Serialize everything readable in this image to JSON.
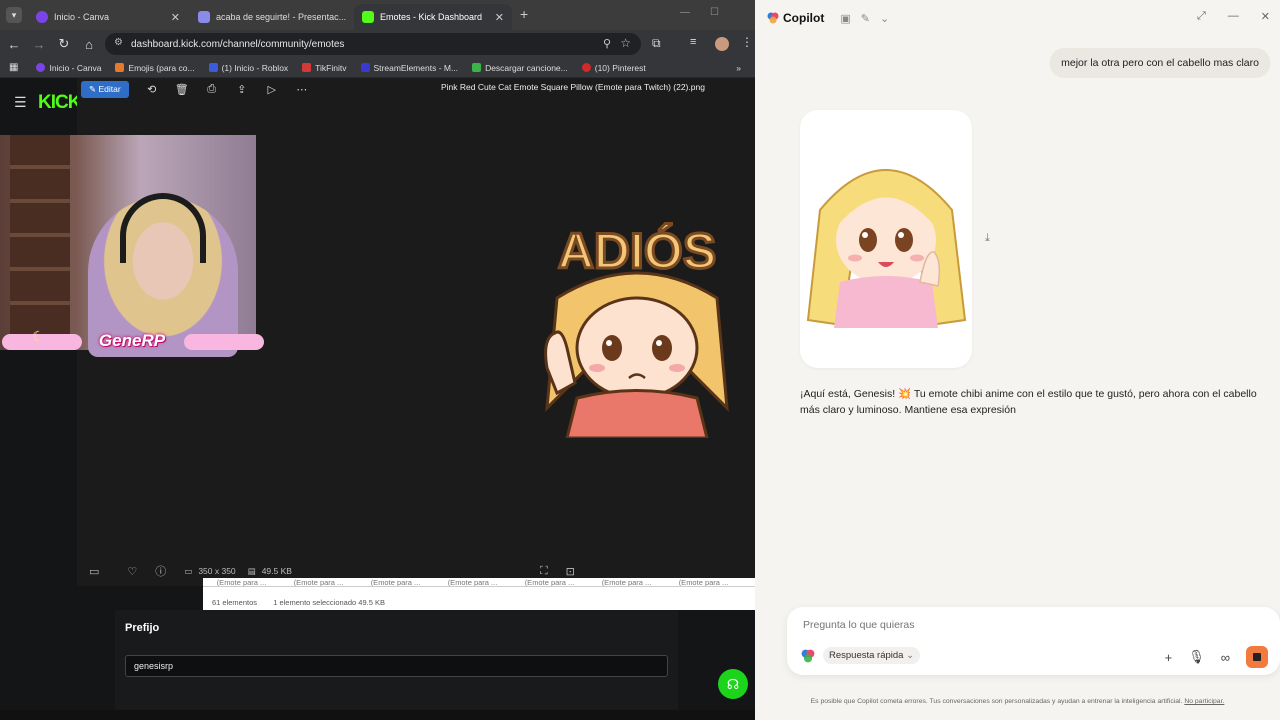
{
  "browser": {
    "tabs": [
      {
        "label": "Inicio - Canva",
        "color": "#7b44e6"
      },
      {
        "label": "acaba de seguirte! - Presentac...",
        "color": "#2f7de1"
      },
      {
        "label": "Emotes - Kick Dashboard",
        "color": "#53fc18"
      }
    ],
    "url": "dashboard.kick.com/channel/community/emotes",
    "bookmarks": [
      {
        "label": "Inicio - Canva",
        "color": "#7b44e6"
      },
      {
        "label": "Emojis (para co...",
        "color": "#e67a2a"
      },
      {
        "label": "(1) Inicio - Roblox",
        "color": "#3b5bdb"
      },
      {
        "label": "TikFinitv",
        "color": "#d13a3a"
      },
      {
        "label": "StreamElements - M...",
        "color": "#3a3ad1"
      },
      {
        "label": "Descargar cancione...",
        "color": "#3ab34a"
      },
      {
        "label": "(10) Pinterest",
        "color": "#d12a2a"
      }
    ]
  },
  "viewer": {
    "edit_label": "Editar",
    "title": "Pink Red Cute Cat Emote Square Pillow (Emote para Twitch) (22).png",
    "dimensions": "350 x 350",
    "filesize": "49.5 KB",
    "emote_text": "ADIÓS"
  },
  "webcam": {
    "overlay_name": "GeneRP"
  },
  "file_explorer": {
    "columns": [
      "(Emote para ...",
      "(Emote para ...",
      "(Emote para ...",
      "(Emote para ...",
      "(Emote para ...",
      "(Emote para ...",
      "(Emote para ..."
    ],
    "status_count": "61 elementos",
    "status_selected": "1 elemento seleccionado  49.5 KB"
  },
  "kick": {
    "logo": "KICK",
    "prefix_label": "Prefijo",
    "prefix_value": "genesisrp"
  },
  "copilot": {
    "brand": "Copilot",
    "user_message": "mejor la otra pero con el cabello mas claro",
    "ai_message": "¡Aquí está, Genesis! 💥 Tu emote chibi anime con el estilo que te gustó, pero ahora con el cabello más claro y luminoso. Mantiene esa expresión",
    "input_placeholder": "Pregunta lo que quieras",
    "mode_label": "Respuesta rápida",
    "footer_text": "Es posible que Copilot cometa errores. Tus conversaciones son personalizadas y ayudan a entrenar la inteligencia artificial.",
    "footer_link": "No participar."
  }
}
